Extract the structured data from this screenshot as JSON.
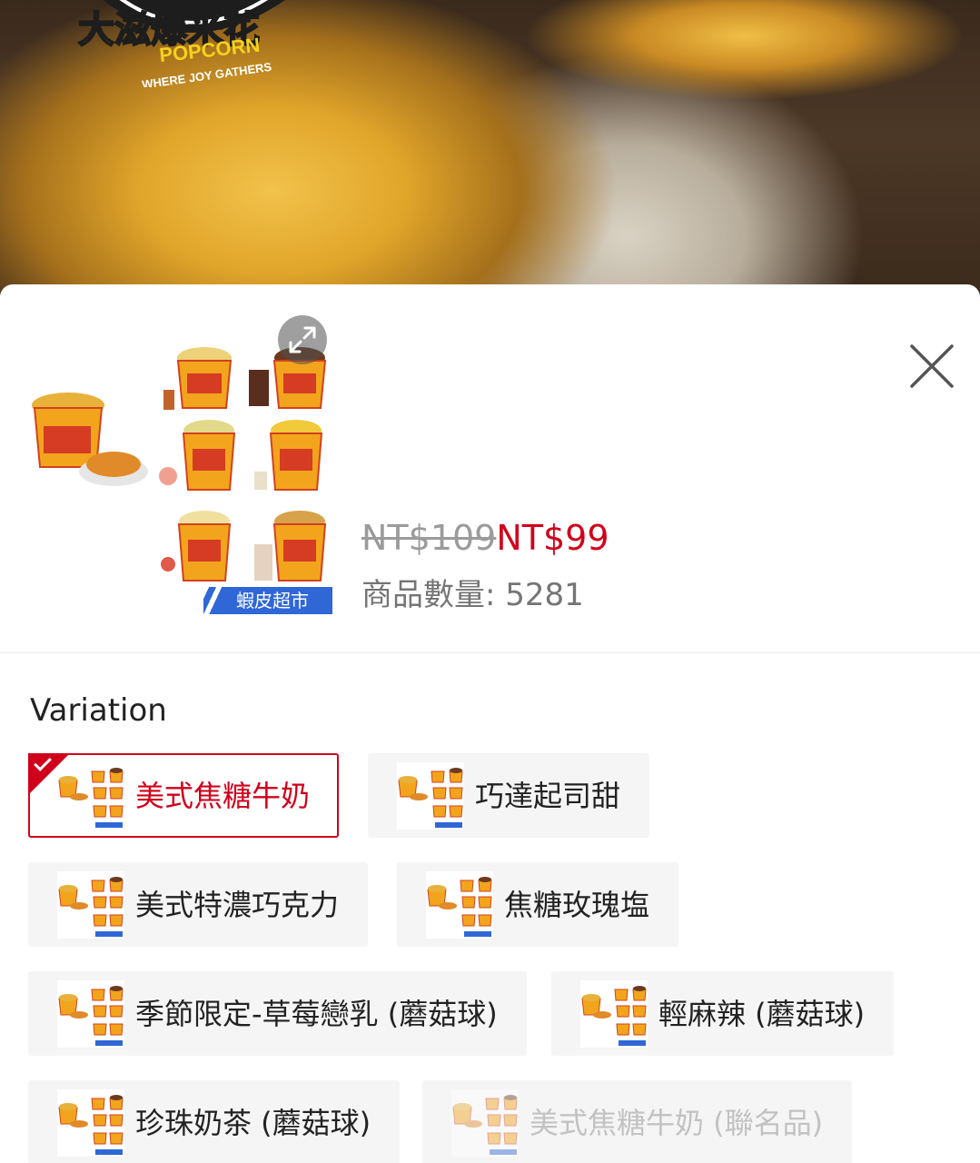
{
  "banner": {
    "logo_line1": "大滋爆米花",
    "logo_line2": "POPCORN",
    "logo_tagline": "WHERE JOY GATHERS"
  },
  "product": {
    "mall_badge": "蝦皮超市",
    "price_original": "NT$109",
    "price_current": "NT$99",
    "stock_label": "商品數量: ",
    "stock_value": "5281"
  },
  "variation": {
    "title": "Variation",
    "options": [
      {
        "label": "美式焦糖牛奶",
        "selected": true,
        "disabled": false
      },
      {
        "label": "巧達起司甜",
        "selected": false,
        "disabled": false
      },
      {
        "label": "美式特濃巧克力",
        "selected": false,
        "disabled": false
      },
      {
        "label": "焦糖玫瑰塩",
        "selected": false,
        "disabled": false
      },
      {
        "label": "季節限定-草莓戀乳 (蘑菇球)",
        "selected": false,
        "disabled": false
      },
      {
        "label": "輕麻辣 (蘑菇球)",
        "selected": false,
        "disabled": false
      },
      {
        "label": "珍珠奶茶 (蘑菇球)",
        "selected": false,
        "disabled": false
      },
      {
        "label": "美式焦糖牛奶 (聯名品)",
        "selected": false,
        "disabled": true
      }
    ]
  },
  "colors": {
    "accent": "#d0011b",
    "mall_blue": "#2f67d6",
    "muted_text": "#757575",
    "chip_bg": "#f5f5f5"
  },
  "icons": {
    "close": "close-icon",
    "expand": "expand-icon",
    "selected_check": "check-icon"
  }
}
